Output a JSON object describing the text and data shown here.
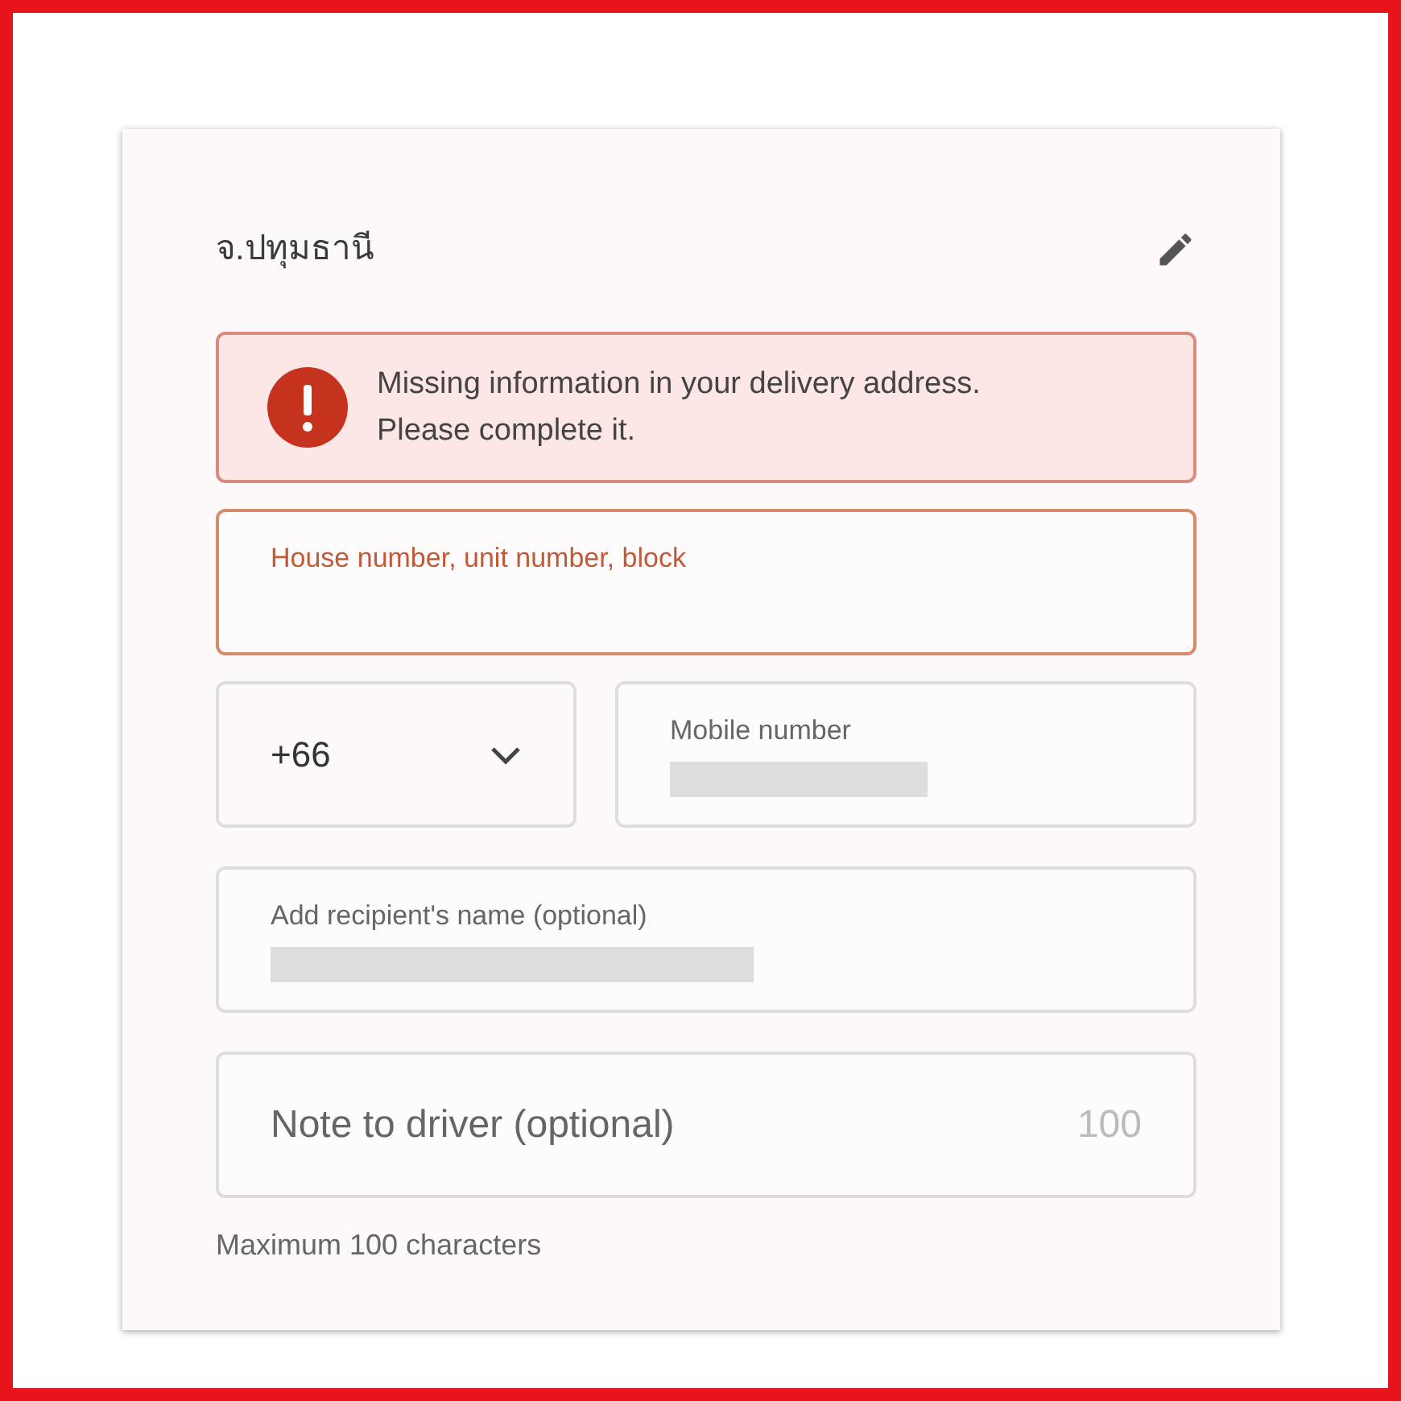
{
  "card": {
    "title": "จ.ปทุมธานี"
  },
  "alert": {
    "lines": [
      "Missing information in your delivery address.",
      "Please complete it."
    ]
  },
  "fields": [
    {
      "kind": "text",
      "label": "House number, unit number, block",
      "error": true,
      "redacted": false
    },
    {
      "kind": "phone",
      "country_code": "+66",
      "label": "Mobile number",
      "error": false,
      "redacted": true
    },
    {
      "kind": "text",
      "label": "Add recipient's name (optional)",
      "error": false,
      "redacted": true
    },
    {
      "kind": "note",
      "placeholder": "Note to driver (optional)",
      "counter": "100",
      "error": false
    }
  ],
  "helper": "Maximum 100 characters"
}
